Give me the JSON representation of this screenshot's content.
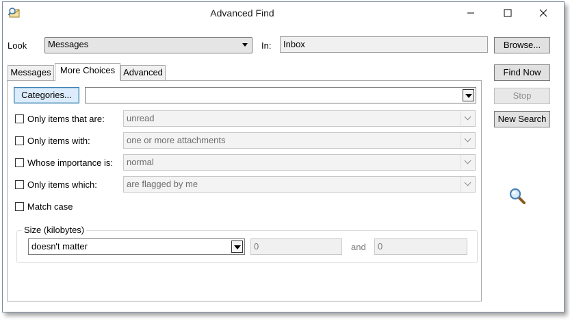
{
  "window": {
    "title": "Advanced Find"
  },
  "look": {
    "label": "Look",
    "value": "Messages",
    "in_label": "In:",
    "in_value": "Inbox"
  },
  "tabs": [
    {
      "label": "Messages"
    },
    {
      "label": "More Choices"
    },
    {
      "label": "Advanced"
    }
  ],
  "buttons": {
    "browse": "Browse...",
    "find_now": "Find Now",
    "stop": "Stop",
    "new_search": "New Search",
    "categories": "Categories..."
  },
  "more_choices": {
    "categories_value": "",
    "options": [
      {
        "label": "Only items that are:",
        "value": "unread"
      },
      {
        "label": "Only items with:",
        "value": "one or more attachments"
      },
      {
        "label": "Whose importance is:",
        "value": "normal"
      },
      {
        "label": "Only items which:",
        "value": "are flagged by me"
      }
    ],
    "match_case": "Match case",
    "size": {
      "title": "Size (kilobytes)",
      "condition": "doesn't matter",
      "from": "0",
      "and_label": "and",
      "to": "0"
    }
  },
  "icons": {
    "app": "advanced-find-app-icon",
    "search": "magnifier-icon"
  }
}
